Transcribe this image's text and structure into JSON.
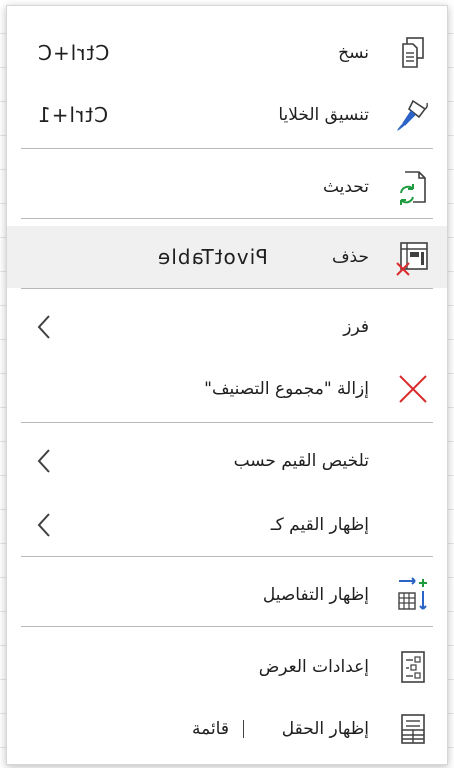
{
  "menu": {
    "copy": {
      "label": "نسخ",
      "shortcut": "Ctrl+C",
      "icon": "copy-icon"
    },
    "format_cells": {
      "label": "تنسيق الخلايا",
      "shortcut": "Ctrl+1",
      "icon": "paintbrush-icon"
    },
    "refresh": {
      "label": "تحديث",
      "icon": "refresh-icon"
    },
    "delete": {
      "label": "حذف",
      "extra": "PivotTable",
      "icon": "pivot-delete-icon"
    },
    "sort": {
      "label": "فرز",
      "icon": "chevron-left-icon"
    },
    "remove_subtotal": {
      "label": "إزالة \"مجموع التصنيف\"",
      "icon": "red-x-icon"
    },
    "summarize_by": {
      "label": "تلخيص القيم حسب",
      "icon": "chevron-left-icon"
    },
    "show_values_as": {
      "label": "إظهار القيم كـ",
      "icon": "chevron-left-icon"
    },
    "show_details": {
      "label": "إظهار التفاصيل",
      "icon": "details-icon"
    },
    "display_settings": {
      "label": "إعدادات العرض",
      "icon": "settings-icon"
    },
    "show_field_list": {
      "label": "إظهار الحقل",
      "extra": "قائمة",
      "icon": "field-list-icon"
    }
  },
  "colors": {
    "accent_blue": "#2b63c6",
    "accent_green": "#1e9b3f",
    "accent_red": "#d92b2b"
  }
}
